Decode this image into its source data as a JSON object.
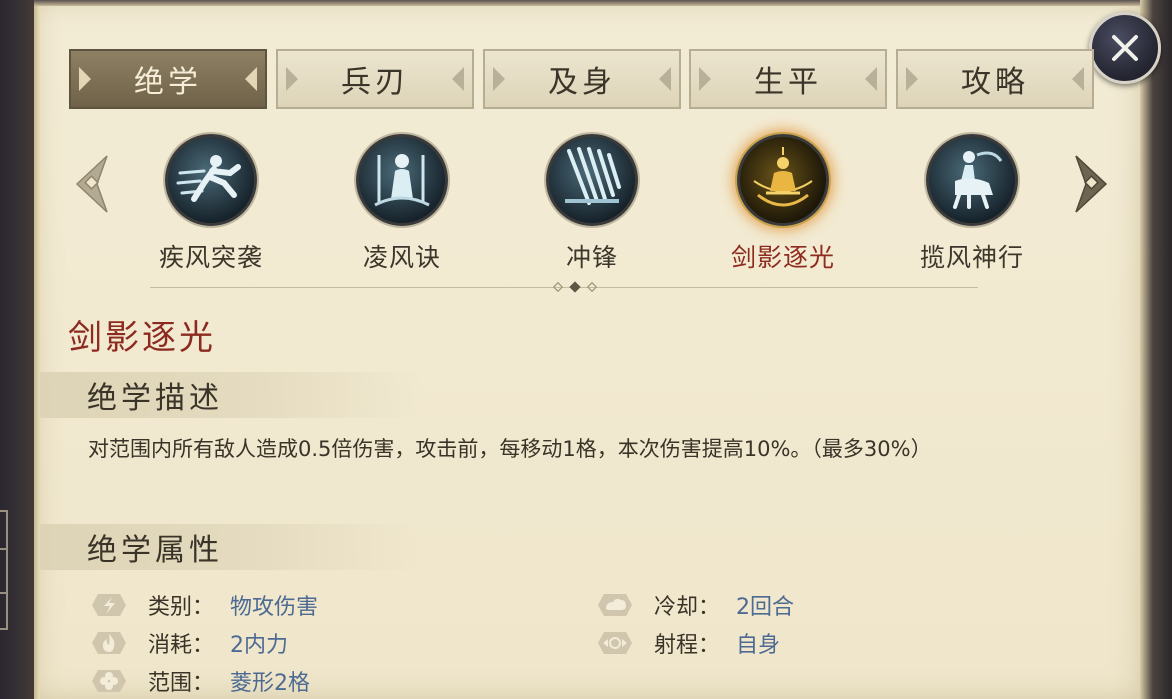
{
  "tabs": [
    {
      "label": "绝学",
      "active": true
    },
    {
      "label": "兵刃",
      "active": false
    },
    {
      "label": "及身",
      "active": false
    },
    {
      "label": "生平",
      "active": false
    },
    {
      "label": "攻略",
      "active": false
    }
  ],
  "skills": [
    {
      "name": "疾风突袭",
      "icon": "running-figure-icon",
      "selected": false
    },
    {
      "name": "凌风诀",
      "icon": "wind-swordsman-icon",
      "selected": false
    },
    {
      "name": "冲锋",
      "icon": "charge-streak-icon",
      "selected": false
    },
    {
      "name": "剑影逐光",
      "icon": "meditating-golden-icon",
      "selected": true
    },
    {
      "name": "揽风神行",
      "icon": "centaur-rider-icon",
      "selected": false
    }
  ],
  "detail": {
    "title": "剑影逐光",
    "description_heading": "绝学描述",
    "description": "对范围内所有敌人造成0.5倍伤害，攻击前，每移动1格，本次伤害提高10%。（最多30%）",
    "attributes_heading": "绝学属性",
    "attributes": {
      "category": {
        "label": "类别：",
        "value": "物攻伤害",
        "icon": "lightning-icon"
      },
      "cooldown": {
        "label": "冷却：",
        "value": "2回合",
        "icon": "cloud-icon"
      },
      "cost": {
        "label": "消耗：",
        "value": "2内力",
        "icon": "flame-icon"
      },
      "range": {
        "label": "射程：",
        "value": "自身",
        "icon": "target-arrows-icon"
      },
      "area": {
        "label": "范围：",
        "value": "菱形2格",
        "icon": "clover-icon"
      }
    }
  },
  "colors": {
    "parchment": "#efe6cb",
    "selected_name": "#8c2a20",
    "attribute_value": "#4c6a92",
    "active_tab": "#7f7256"
  }
}
